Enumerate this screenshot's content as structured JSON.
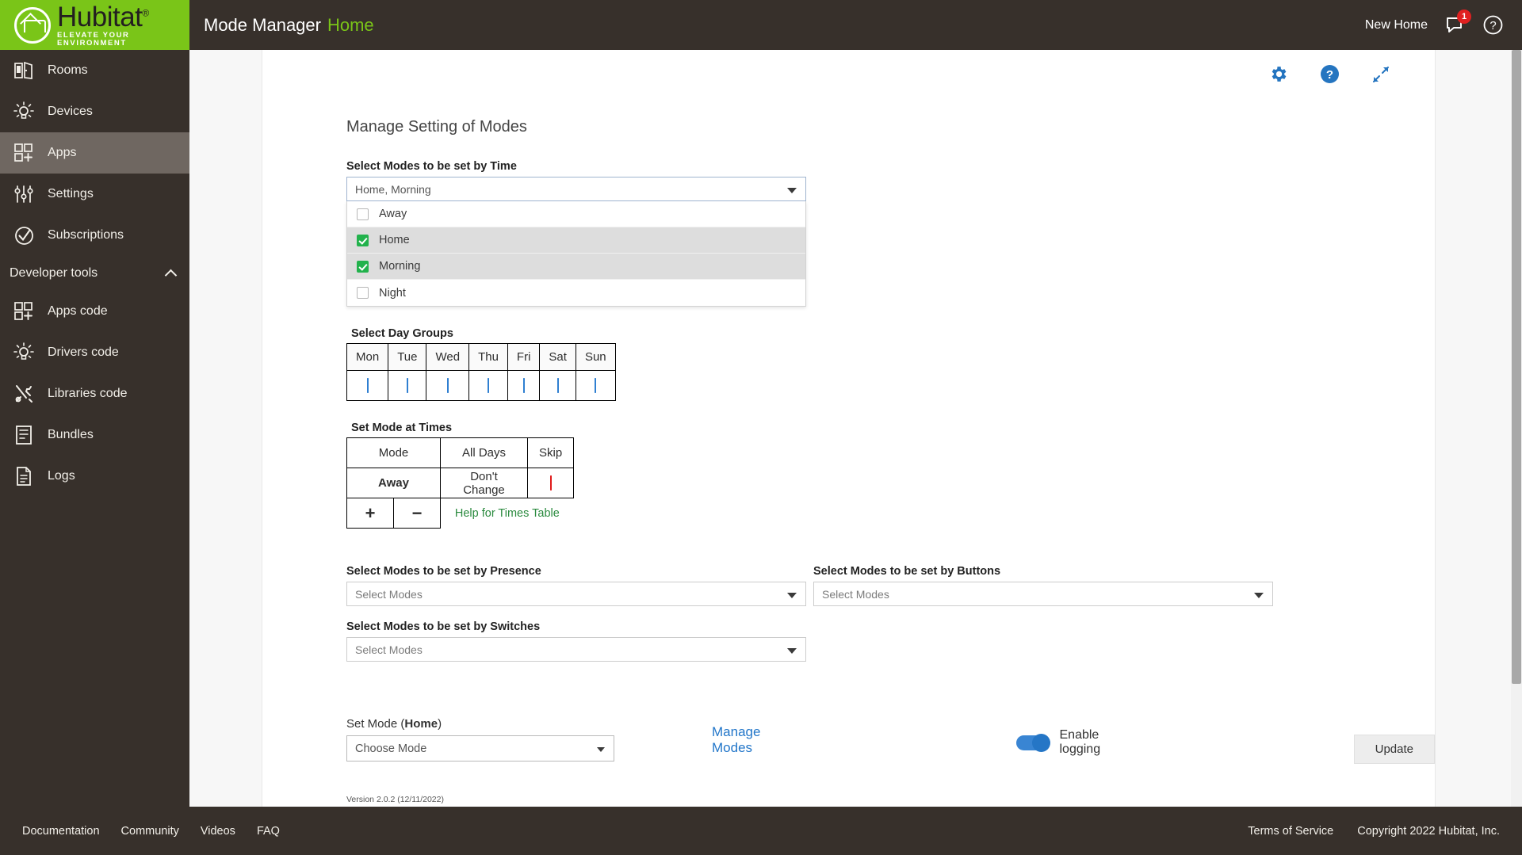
{
  "brand": {
    "name": "Hubitat",
    "tagline": "ELEVATE YOUR ENVIRONMENT",
    "green": "#7ac518",
    "dark": "#37302b"
  },
  "sidebar": {
    "items": [
      {
        "label": "Rooms",
        "icon": "rooms-icon",
        "active": false
      },
      {
        "label": "Devices",
        "icon": "devices-icon",
        "active": false
      },
      {
        "label": "Apps",
        "icon": "apps-icon",
        "active": true
      },
      {
        "label": "Settings",
        "icon": "settings-icon",
        "active": false
      },
      {
        "label": "Subscriptions",
        "icon": "subscriptions-icon",
        "active": false
      }
    ],
    "section": {
      "label": "Developer tools",
      "expanded": true
    },
    "dev_items": [
      {
        "label": "Apps code",
        "icon": "apps-code-icon"
      },
      {
        "label": "Drivers code",
        "icon": "drivers-code-icon"
      },
      {
        "label": "Libraries code",
        "icon": "libraries-code-icon"
      },
      {
        "label": "Bundles",
        "icon": "bundles-icon"
      },
      {
        "label": "Logs",
        "icon": "logs-icon"
      }
    ]
  },
  "topbar": {
    "title": "Mode Manager",
    "subtitle": "Home",
    "hub_name": "New Home",
    "notification_count": "1"
  },
  "card_icons": {
    "gear": "gear-icon",
    "help": "help-icon",
    "expand": "expand-icon"
  },
  "main": {
    "page_title": "Manage Setting of Modes",
    "modes_by_time": {
      "label": "Select Modes to be set by Time",
      "value": "Home, Morning",
      "options": [
        {
          "label": "Away",
          "checked": false
        },
        {
          "label": "Home",
          "checked": true
        },
        {
          "label": "Morning",
          "checked": true
        },
        {
          "label": "Night",
          "checked": false
        }
      ]
    },
    "day_groups": {
      "label": "Select Day Groups",
      "days": [
        "Mon",
        "Tue",
        "Wed",
        "Thu",
        "Fri",
        "Sat",
        "Sun"
      ],
      "checked": [
        true,
        true,
        true,
        true,
        true,
        true,
        true
      ]
    },
    "times_table": {
      "label": "Set Mode at Times",
      "headers": [
        "Mode",
        "All Days",
        "Skip"
      ],
      "rows": [
        {
          "mode": "Away",
          "days": "Don't Change",
          "skip": true
        }
      ],
      "add_label": "+",
      "remove_label": "−",
      "help_label": "Help for Times Table"
    },
    "modes_by_presence": {
      "label": "Select Modes to be set by Presence",
      "placeholder": "Select Modes"
    },
    "modes_by_buttons": {
      "label": "Select Modes to be set by Buttons",
      "placeholder": "Select Modes"
    },
    "modes_by_switches": {
      "label": "Select Modes to be set by Switches",
      "placeholder": "Select Modes"
    },
    "set_mode": {
      "label_prefix": "Set Mode (",
      "label_mode": "Home",
      "label_suffix": ")",
      "placeholder": "Choose Mode"
    },
    "manage_modes_link": "Manage Modes",
    "logging": {
      "label": "Enable logging",
      "enabled": true
    },
    "update_button": "Update",
    "version": "Version 2.0.2 (12/11/2022)"
  },
  "footer": {
    "left": [
      "Documentation",
      "Community",
      "Videos",
      "FAQ"
    ],
    "right": [
      "Terms of Service",
      "Copyright 2022 Hubitat, Inc."
    ]
  }
}
